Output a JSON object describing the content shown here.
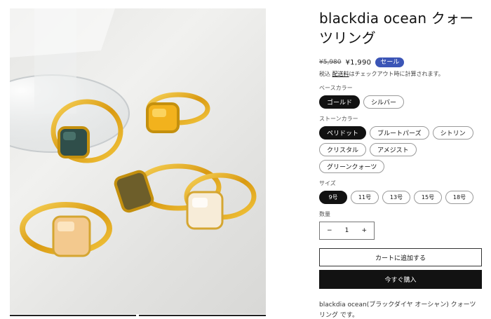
{
  "product": {
    "title": "blackdia ocean クォーツリング",
    "price_old": "¥5,980",
    "price_now": "¥1,990",
    "sale_badge": "セール",
    "tax_prefix": "税込",
    "tax_link": "配送料",
    "tax_suffix": "はチェックアウト時に計算されます。",
    "description": "blackdia ocean(ブラックダイヤ オーシャン) クォーツリング です。"
  },
  "options": {
    "base_label": "ベースカラー",
    "base": [
      {
        "label": "ゴールド",
        "selected": true
      },
      {
        "label": "シルバー",
        "selected": false
      }
    ],
    "stone_label": "ストーンカラー",
    "stone": [
      {
        "label": "ペリドット",
        "selected": true
      },
      {
        "label": "ブルートパーズ",
        "selected": false
      },
      {
        "label": "シトリン",
        "selected": false
      },
      {
        "label": "クリスタル",
        "selected": false
      },
      {
        "label": "アメジスト",
        "selected": false
      },
      {
        "label": "グリーンクォーツ",
        "selected": false
      }
    ],
    "size_label": "サイズ",
    "size": [
      {
        "label": "9号",
        "selected": true
      },
      {
        "label": "11号",
        "selected": false
      },
      {
        "label": "13号",
        "selected": false
      },
      {
        "label": "15号",
        "selected": false
      },
      {
        "label": "18号",
        "selected": false
      }
    ]
  },
  "quantity": {
    "label": "数量",
    "value": "1",
    "minus": "−",
    "plus": "+"
  },
  "buttons": {
    "add_to_cart": "カートに追加する",
    "buy_now": "今すぐ購入"
  },
  "colors": {
    "accent_badge": "#3b55b6",
    "dark": "#121212"
  }
}
